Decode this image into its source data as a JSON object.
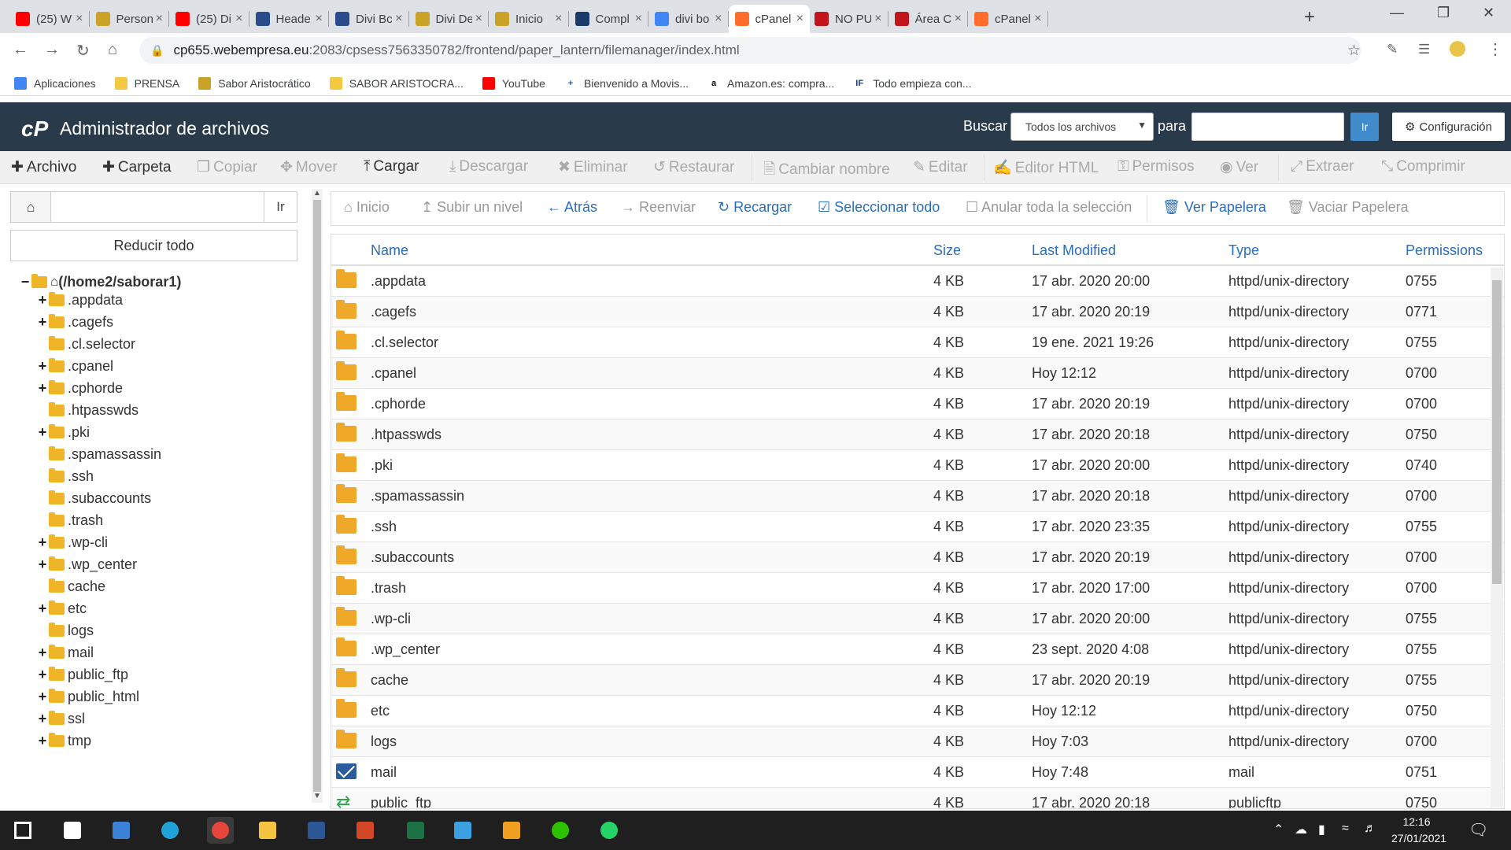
{
  "browser": {
    "tabs": [
      {
        "title": "(25) W",
        "icon": "youtube-icon",
        "color": "#ff0000"
      },
      {
        "title": "Person",
        "icon": "webempresa-icon",
        "color": "#c9a227"
      },
      {
        "title": "(25) Di",
        "icon": "youtube-icon",
        "color": "#ff0000"
      },
      {
        "title": "Heade",
        "icon": "divi-icon",
        "color": "#2b4c8c"
      },
      {
        "title": "Divi Bc",
        "icon": "divi-icon",
        "color": "#2b4c8c"
      },
      {
        "title": "Divi De",
        "icon": "webempresa-icon",
        "color": "#c9a227"
      },
      {
        "title": "Inicio",
        "icon": "webempresa-icon",
        "color": "#c9a227"
      },
      {
        "title": "Compl",
        "icon": "info-icon",
        "color": "#1a3a6b"
      },
      {
        "title": "divi bo",
        "icon": "google-icon",
        "color": "#4285f4"
      },
      {
        "title": "cPanel",
        "icon": "cpanel-icon",
        "color": "#ff6c2c",
        "active": true
      },
      {
        "title": "NO PU",
        "icon": "webempresa-w-icon",
        "color": "#c4141b"
      },
      {
        "title": "Área C",
        "icon": "webempresa-w-icon",
        "color": "#c4141b"
      },
      {
        "title": "cPanel",
        "icon": "cpanel-icon",
        "color": "#ff6c2c"
      }
    ],
    "url_host": "cp655.webempresa.eu",
    "url_path": ":2083/cpsess7563350782/frontend/paper_lantern/filemanager/index.html",
    "bookmarks": [
      {
        "label": "Aplicaciones",
        "icon": "apps-grid-icon",
        "color": "#4285f4"
      },
      {
        "label": "PRENSA",
        "icon": "folder-icon",
        "color": "#f5c842"
      },
      {
        "label": "Sabor Aristocrático",
        "icon": "webempresa-icon",
        "color": "#c9a227"
      },
      {
        "label": "SABOR ARISTOCRA...",
        "icon": "folder-icon",
        "color": "#f5c842"
      },
      {
        "label": "YouTube",
        "icon": "youtube-icon",
        "color": "#ff0000"
      },
      {
        "label": "Bienvenido a Movis...",
        "icon": "plus-icon",
        "color": "#1a5fb4"
      },
      {
        "label": "Amazon.es: compra...",
        "icon": "amazon-icon",
        "color": "#000000"
      },
      {
        "label": "Todo empieza con...",
        "icon": "if-icon",
        "color": "#1a3a8c"
      }
    ]
  },
  "header": {
    "title": "Administrador de archivos",
    "search_label": "Buscar",
    "scope_value": "Todos los archivos",
    "para_label": "para",
    "go_label": "Ir",
    "config_label": "Configuración"
  },
  "toolbar": {
    "archivo": "Archivo",
    "carpeta": "Carpeta",
    "copiar": "Copiar",
    "mover": "Mover",
    "cargar": "Cargar",
    "descargar": "Descargar",
    "eliminar": "Eliminar",
    "restaurar": "Restaurar",
    "cambiar_nombre": "Cambiar nombre",
    "editar": "Editar",
    "editor_html": "Editor HTML",
    "permisos": "Permisos",
    "ver": "Ver",
    "extraer": "Extraer",
    "comprimir": "Comprimir"
  },
  "left": {
    "go_label": "Ir",
    "collapse_label": "Reducir todo",
    "root": "(/home2/saborar1)",
    "tree": [
      {
        "name": ".appdata",
        "expandable": true
      },
      {
        "name": ".cagefs",
        "expandable": true
      },
      {
        "name": ".cl.selector",
        "expandable": false
      },
      {
        "name": ".cpanel",
        "expandable": true
      },
      {
        "name": ".cphorde",
        "expandable": true
      },
      {
        "name": ".htpasswds",
        "expandable": false
      },
      {
        "name": ".pki",
        "expandable": true
      },
      {
        "name": ".spamassassin",
        "expandable": false
      },
      {
        "name": ".ssh",
        "expandable": false
      },
      {
        "name": ".subaccounts",
        "expandable": false
      },
      {
        "name": ".trash",
        "expandable": false
      },
      {
        "name": ".wp-cli",
        "expandable": true
      },
      {
        "name": ".wp_center",
        "expandable": true
      },
      {
        "name": "cache",
        "expandable": false
      },
      {
        "name": "etc",
        "expandable": true
      },
      {
        "name": "logs",
        "expandable": false
      },
      {
        "name": "mail",
        "expandable": true
      },
      {
        "name": "public_ftp",
        "expandable": true
      },
      {
        "name": "public_html",
        "expandable": true
      },
      {
        "name": "ssl",
        "expandable": true
      },
      {
        "name": "tmp",
        "expandable": true
      }
    ]
  },
  "nav": {
    "inicio": "Inicio",
    "subir": "Subir un nivel",
    "atras": "Atrás",
    "reenviar": "Reenviar",
    "recargar": "Recargar",
    "seleccionar": "Seleccionar todo",
    "anular": "Anular toda la selección",
    "ver_papelera": "Ver Papelera",
    "vaciar_papelera": "Vaciar Papelera"
  },
  "table": {
    "headers": {
      "name": "Name",
      "size": "Size",
      "modified": "Last Modified",
      "type": "Type",
      "perms": "Permissions"
    },
    "rows": [
      {
        "icon": "folder",
        "name": ".appdata",
        "size": "4 KB",
        "modified": "17 abr. 2020 20:00",
        "type": "httpd/unix-directory",
        "perms": "0755"
      },
      {
        "icon": "folder",
        "name": ".cagefs",
        "size": "4 KB",
        "modified": "17 abr. 2020 20:19",
        "type": "httpd/unix-directory",
        "perms": "0771"
      },
      {
        "icon": "folder",
        "name": ".cl.selector",
        "size": "4 KB",
        "modified": "19 ene. 2021 19:26",
        "type": "httpd/unix-directory",
        "perms": "0755"
      },
      {
        "icon": "folder",
        "name": ".cpanel",
        "size": "4 KB",
        "modified": "Hoy 12:12",
        "type": "httpd/unix-directory",
        "perms": "0700"
      },
      {
        "icon": "folder",
        "name": ".cphorde",
        "size": "4 KB",
        "modified": "17 abr. 2020 20:19",
        "type": "httpd/unix-directory",
        "perms": "0700"
      },
      {
        "icon": "folder",
        "name": ".htpasswds",
        "size": "4 KB",
        "modified": "17 abr. 2020 20:18",
        "type": "httpd/unix-directory",
        "perms": "0750"
      },
      {
        "icon": "folder",
        "name": ".pki",
        "size": "4 KB",
        "modified": "17 abr. 2020 20:00",
        "type": "httpd/unix-directory",
        "perms": "0740"
      },
      {
        "icon": "folder",
        "name": ".spamassassin",
        "size": "4 KB",
        "modified": "17 abr. 2020 20:18",
        "type": "httpd/unix-directory",
        "perms": "0700"
      },
      {
        "icon": "folder",
        "name": ".ssh",
        "size": "4 KB",
        "modified": "17 abr. 2020 23:35",
        "type": "httpd/unix-directory",
        "perms": "0755"
      },
      {
        "icon": "folder",
        "name": ".subaccounts",
        "size": "4 KB",
        "modified": "17 abr. 2020 20:19",
        "type": "httpd/unix-directory",
        "perms": "0700"
      },
      {
        "icon": "folder",
        "name": ".trash",
        "size": "4 KB",
        "modified": "17 abr. 2020 17:00",
        "type": "httpd/unix-directory",
        "perms": "0700"
      },
      {
        "icon": "folder",
        "name": ".wp-cli",
        "size": "4 KB",
        "modified": "17 abr. 2020 20:00",
        "type": "httpd/unix-directory",
        "perms": "0755"
      },
      {
        "icon": "folder",
        "name": ".wp_center",
        "size": "4 KB",
        "modified": "23 sept. 2020 4:08",
        "type": "httpd/unix-directory",
        "perms": "0755"
      },
      {
        "icon": "folder",
        "name": "cache",
        "size": "4 KB",
        "modified": "17 abr. 2020 20:19",
        "type": "httpd/unix-directory",
        "perms": "0755"
      },
      {
        "icon": "folder",
        "name": "etc",
        "size": "4 KB",
        "modified": "Hoy 12:12",
        "type": "httpd/unix-directory",
        "perms": "0750"
      },
      {
        "icon": "folder",
        "name": "logs",
        "size": "4 KB",
        "modified": "Hoy 7:03",
        "type": "httpd/unix-directory",
        "perms": "0700"
      },
      {
        "icon": "mail",
        "name": "mail",
        "size": "4 KB",
        "modified": "Hoy 7:48",
        "type": "mail",
        "perms": "0751"
      },
      {
        "icon": "link",
        "name": "public_ftp",
        "size": "4 KB",
        "modified": "17 abr. 2020 20:18",
        "type": "publicftp",
        "perms": "0750"
      }
    ]
  },
  "taskbar": {
    "time": "12:16",
    "date": "27/01/2021",
    "apps": [
      "windows-start-icon",
      "store-icon",
      "mail-icon",
      "edge-icon",
      "chrome-icon",
      "explorer-icon",
      "word-icon",
      "powerpoint-icon",
      "excel-icon",
      "install-icon",
      "sunflower-icon",
      "wechat-icon",
      "whatsapp-icon"
    ]
  }
}
